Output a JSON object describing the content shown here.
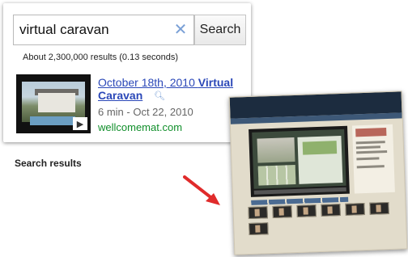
{
  "search": {
    "query": "virtual caravan",
    "clear_icon": "close-icon",
    "button_label": "Search",
    "stats": "About 2,300,000 results (0.13 seconds)"
  },
  "result": {
    "title_prefix": "October 18th, 2010 ",
    "title_bold": "Virtual Caravan",
    "meta": "6 min - Oct 22, 2010",
    "url": "wellcomemat.com",
    "thumbnail_icon": "play-icon",
    "preview_icon": "magnifier-icon"
  },
  "caption": "Search results",
  "colors": {
    "link": "#2b48b8",
    "url": "#118f2b",
    "arrow": "#e02b2b",
    "site_header": "#1c2c3f"
  }
}
